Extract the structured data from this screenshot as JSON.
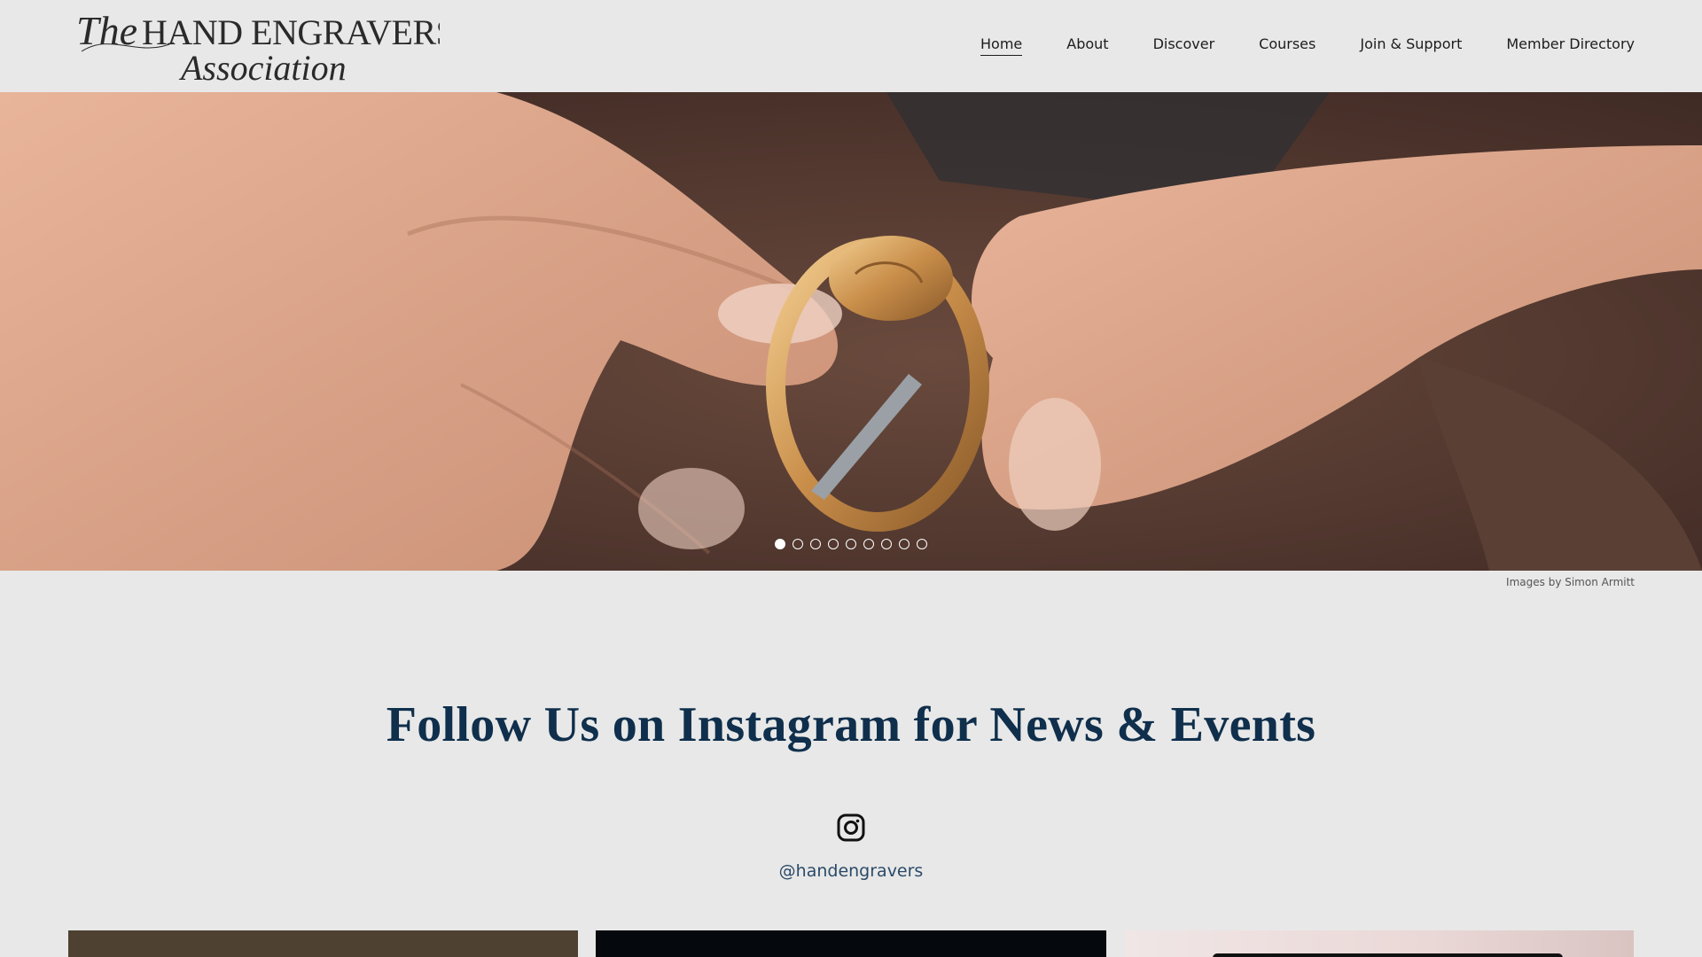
{
  "site": {
    "logo_line1_script": "The",
    "logo_line1": "HAND ENGRAVERS",
    "logo_line2": "Association"
  },
  "nav": {
    "items": [
      {
        "label": "Home",
        "active": true
      },
      {
        "label": "About"
      },
      {
        "label": "Discover"
      },
      {
        "label": "Courses"
      },
      {
        "label": "Join & Support"
      },
      {
        "label": "Member Directory"
      }
    ]
  },
  "hero": {
    "slide_count": 9,
    "active_slide": 1,
    "credit": "Images by Simon Armitt"
  },
  "instagram": {
    "title": "Follow Us on Instagram for News & Events",
    "icon": "instagram-icon",
    "handle": "@handengravers"
  },
  "colors": {
    "background": "#e8e8e8",
    "title": "#0f2f4c",
    "handle": "#2a4a68"
  }
}
